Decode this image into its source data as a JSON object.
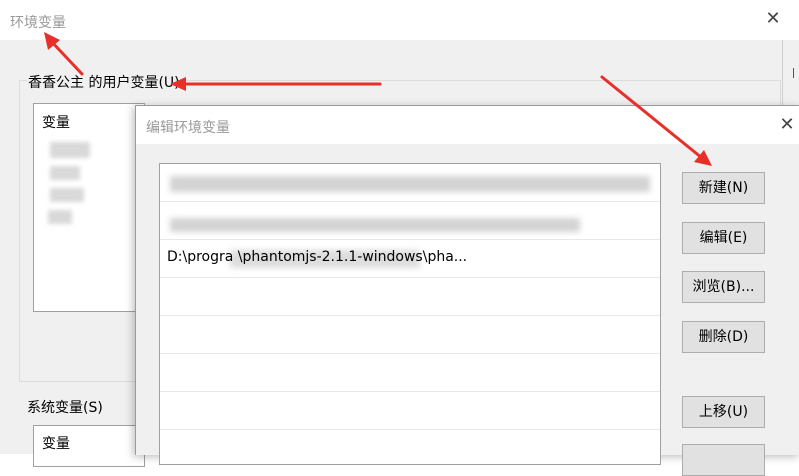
{
  "outer_dialog": {
    "title": "环境变量",
    "close_glyph": "✕",
    "user_vars_label": "香香公主 的用户变量(U)",
    "user_vars_column": "变量",
    "system_vars_label": "系统变量(S)",
    "system_vars_column": "变量"
  },
  "inner_dialog": {
    "title": "编辑环境变量",
    "close_glyph": "✕",
    "path_entries": [
      "",
      "",
      "D:\\progra                  \\phantomjs-2.1.1-windows\\pha..."
    ],
    "buttons": {
      "new": "新建(N)",
      "edit": "编辑(E)",
      "browse": "浏览(B)...",
      "delete": "删除(D)",
      "move_up": "上移(U)"
    }
  },
  "annotation_color": "#e8302a",
  "icons": {
    "close": "close-icon"
  }
}
